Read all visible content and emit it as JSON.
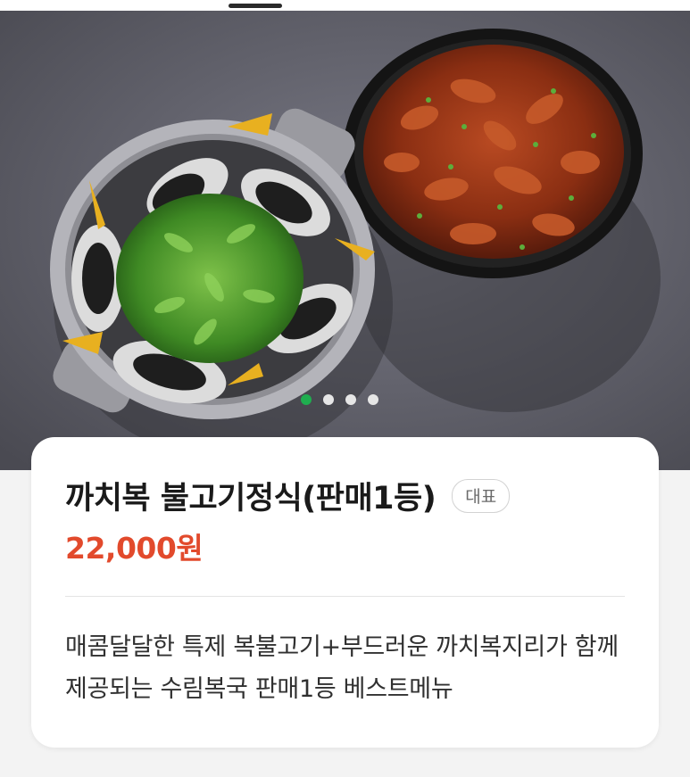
{
  "menu_item": {
    "title": "까치복 불고기정식(판매1등)",
    "tag": "대표",
    "price": "22,000원",
    "description": "매콤달달한 특제 복불고기+부드러운 까치복지리가 함께 제공되는 수림복국 판매1등 베스트메뉴"
  },
  "carousel": {
    "total": 4,
    "active_index": 0
  },
  "colors": {
    "price": "#e24a2c",
    "active_dot": "#1fae4f"
  }
}
